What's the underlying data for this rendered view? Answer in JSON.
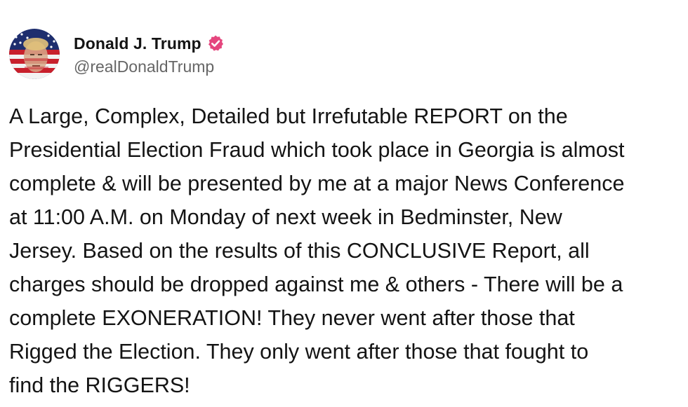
{
  "author": {
    "display_name": "Donald J. Trump",
    "handle": "@realDonaldTrump",
    "verified": true,
    "verified_icon": "verified-badge-icon",
    "verified_color": "#e5467e"
  },
  "post": {
    "text": "A Large, Complex, Detailed but Irrefutable REPORT on the\nPresidential Election Fraud which took place in Georgia is almost\ncomplete & will be presented by me at a major News Conference\nat 11:00 A.M. on Monday of next week in Bedminster, New\nJersey. Based on the results of this CONCLUSIVE Report, all\ncharges should be dropped against me & others - There will be a\ncomplete EXONERATION! They never went after those that\nRigged the Election. They only went after those that fought to\nfind the RIGGERS!"
  },
  "colors": {
    "text": "#141414",
    "handle": "#666666",
    "background": "#ffffff"
  }
}
